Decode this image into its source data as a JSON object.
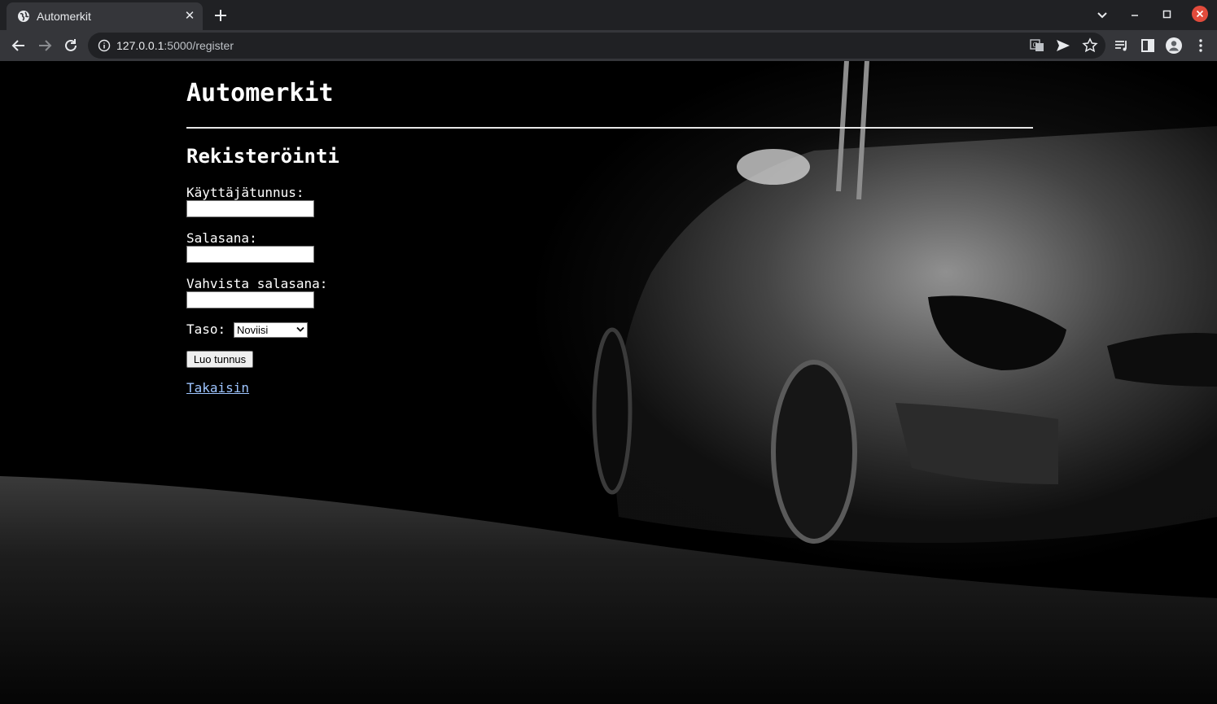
{
  "browser": {
    "tab_title": "Automerkit",
    "url_host": "127.0.0.1",
    "url_path": ":5000/register",
    "icons": [
      "globe-icon",
      "close-icon",
      "plus-icon",
      "chevron-down-icon",
      "minimize-icon",
      "maximize-icon",
      "window-close-icon",
      "back-arrow-icon",
      "forward-arrow-icon",
      "reload-icon",
      "info-icon",
      "translate-icon",
      "send-icon",
      "star-icon",
      "media-queue-icon",
      "side-panel-icon",
      "profile-icon",
      "kebab-menu-icon"
    ],
    "colors": {
      "chrome_dark": "#202124",
      "chrome_tab": "#35363a",
      "close_red": "#e24b3c"
    }
  },
  "page": {
    "heading": "Automerkit",
    "subheading": "Rekisteröinti",
    "form": {
      "username_label": "Käyttäjätunnus:",
      "username_value": "",
      "password_label": "Salasana:",
      "password_value": "",
      "confirm_label": "Vahvista salasana:",
      "confirm_value": "",
      "level_label": "Taso:",
      "level_selected": "Noviisi",
      "submit_label": "Luo tunnus"
    },
    "back_link": "Takaisin",
    "colors": {
      "background": "#000000",
      "text": "#ffffff",
      "link": "#9ec5ff"
    }
  }
}
